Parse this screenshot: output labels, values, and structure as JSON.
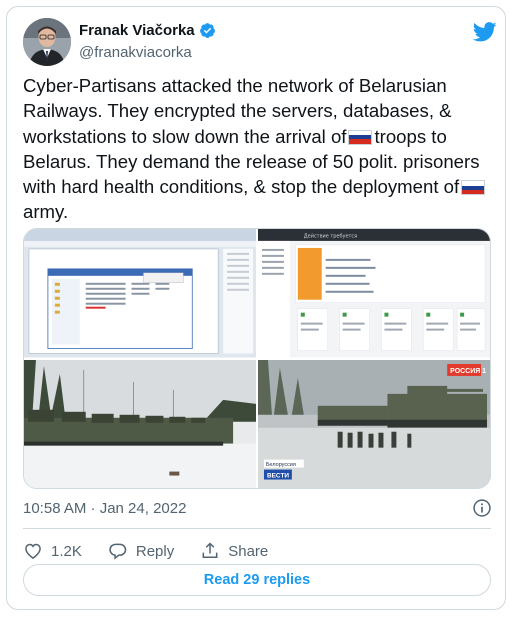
{
  "author": {
    "name": "Franak Viačorka",
    "handle": "@franakviacorka"
  },
  "tweet": {
    "text_1": "Cyber-Partisans attacked the network of Belarusian Railways. They encrypted the servers, databases, & workstations to slow down the arrival of",
    "text_2": "troops to Belarus. They demand the release of 50 polit. prisoners with hard health conditions, & stop the deployment of",
    "text_3": "army."
  },
  "flag_colors": [
    "#ffffff",
    "#1c3f94",
    "#d52b1e"
  ],
  "icons": {
    "verified": "verified-badge-icon",
    "logo": "twitter-bird-icon",
    "info": "info-icon",
    "like": "heart-icon",
    "reply": "reply-bubble-icon",
    "share": "share-icon"
  },
  "media": {
    "image_2": {
      "heading": "Действие требуется",
      "labels": [
        "Изменение",
        "Изменение",
        "Изменение",
        "Изменение",
        "Изменение",
        "Изменение",
        "Изменение"
      ]
    },
    "image_4": {
      "badge": "РОССИЯ 1",
      "caption": "Белоруссия",
      "logo": "ВЕСТИ"
    }
  },
  "timestamp": "10:58 AM · Jan 24, 2022",
  "actions": {
    "likes": "1.2K",
    "reply_label": "Reply",
    "share_label": "Share"
  },
  "read_replies_label": "Read 29 replies",
  "colors": {
    "accent": "#1d9bf0",
    "text_primary": "#0f1419",
    "text_secondary": "#536471",
    "border": "#cfd9de"
  }
}
